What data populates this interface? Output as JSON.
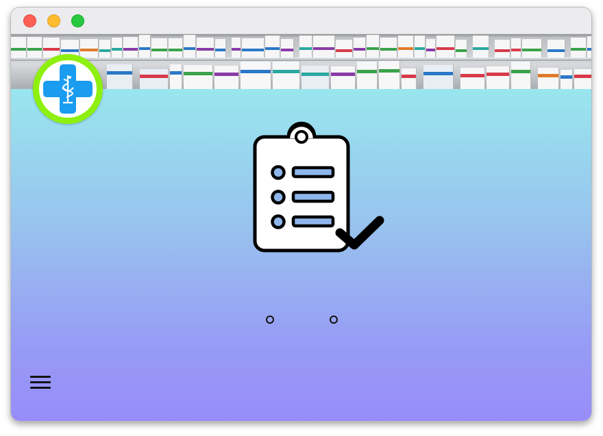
{
  "window": {
    "controls": [
      "close",
      "minimize",
      "zoom"
    ]
  },
  "banner": {
    "image": "pharmacy-shelves-photo"
  },
  "logo": {
    "icon": "medical-cross-caduceus-icon",
    "ring_color": "#8ef00f",
    "cross_color": "#1a9cf0"
  },
  "hero": {
    "icon": "clipboard-checklist-icon",
    "line_color": "#8fb6ec"
  },
  "carousel": {
    "dots": 2
  },
  "menu": {
    "icon": "hamburger-menu-icon"
  },
  "colors": {
    "gradient_top": "#99e6ee",
    "gradient_bottom": "#978cfb"
  }
}
